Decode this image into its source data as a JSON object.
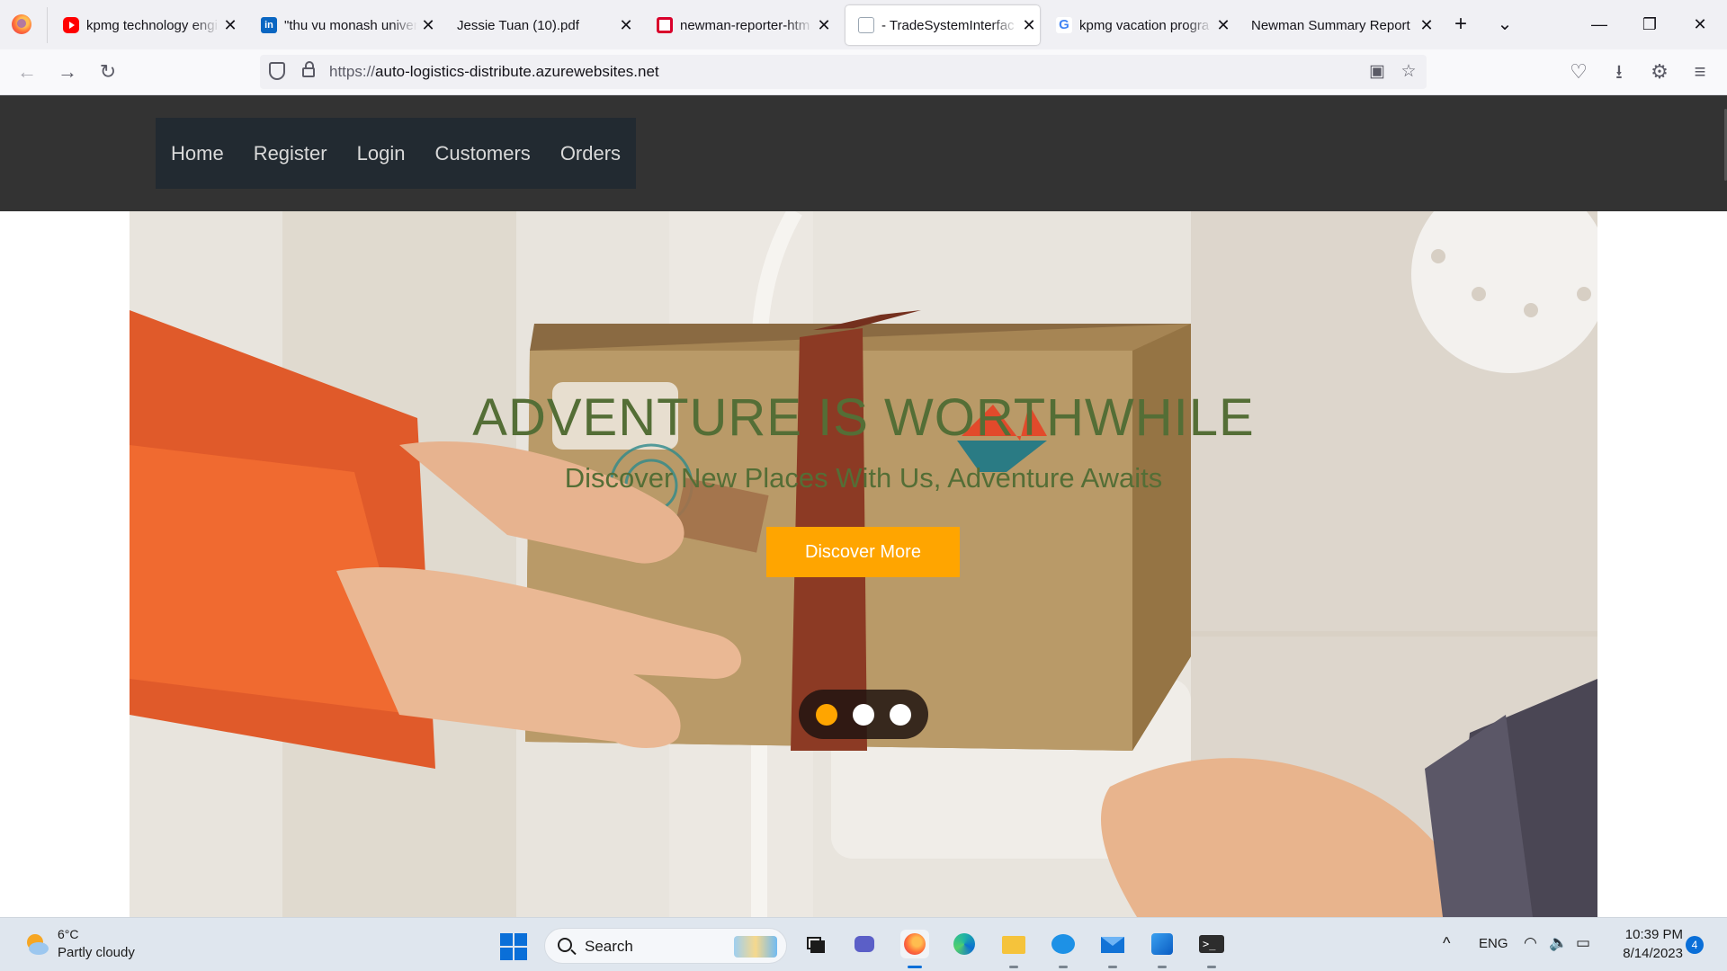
{
  "browser": {
    "tabs": [
      {
        "label": "kpmg technology engi",
        "favicon": "youtube-icon",
        "active": false
      },
      {
        "label": "\"thu vu monash univer",
        "favicon": "linkedin-icon",
        "active": false
      },
      {
        "label": "Jessie Tuan (10).pdf",
        "favicon": "pdf-icon",
        "active": false
      },
      {
        "label": "newman-reporter-htm",
        "favicon": "newman-icon",
        "active": false
      },
      {
        "label": "- TradeSystemInterfac",
        "favicon": "document-icon",
        "active": true
      },
      {
        "label": "kpmg vacation progra",
        "favicon": "google-icon",
        "active": false
      },
      {
        "label": "Newman Summary Report",
        "favicon": "",
        "active": false
      }
    ],
    "new_tab_glyph": "+",
    "list_tabs_glyph": "⌄",
    "close_glyph": "✕",
    "window_controls": {
      "minimize": "—",
      "restore": "❐",
      "close": "✕"
    },
    "nav": {
      "back": "←",
      "forward": "→",
      "reload": "↻"
    },
    "url": {
      "protocol": "https://",
      "host": "auto-logistics-distribute.azurewebsites.net"
    },
    "toolbar_glyphs": {
      "reader": "▣",
      "bookmark": "☆",
      "pocket": "♡",
      "downloads": "⭳",
      "extensions": "⚙",
      "menu": "≡"
    }
  },
  "site": {
    "nav_items": [
      "Home",
      "Register",
      "Login",
      "Customers",
      "Orders"
    ],
    "hero": {
      "title": "ADVENTURE IS WORTHWHILE",
      "subtitle": "Discover New Places With Us, Adventure Awaits",
      "cta_label": "Discover More",
      "slides": 3,
      "active_slide": 1,
      "accent_color": "#ffa500",
      "title_color": "#546e36"
    }
  },
  "taskbar": {
    "weather": {
      "temperature": "6°C",
      "condition": "Partly cloudy"
    },
    "search_label": "Search",
    "apps": [
      "task-view-icon",
      "teams-icon",
      "firefox-icon",
      "edge-icon",
      "file-explorer-icon",
      "docker-icon",
      "mail-icon",
      "photos-icon",
      "terminal-icon"
    ],
    "tray": {
      "chevron": "^",
      "language": "ENG",
      "wifi": "◠",
      "volume": "🔈",
      "battery": "▭"
    },
    "clock": {
      "time": "10:39 PM",
      "date": "8/14/2023"
    },
    "notifications": "4"
  }
}
